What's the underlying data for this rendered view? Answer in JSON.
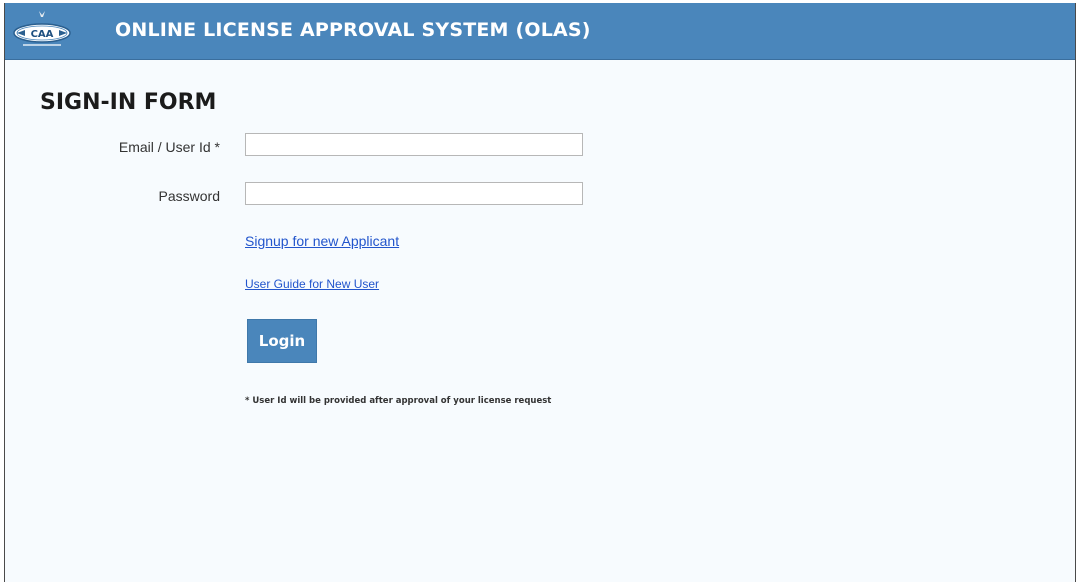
{
  "header": {
    "logo_text": "CAA",
    "title": "ONLINE LICENSE APPROVAL SYSTEM (OLAS)"
  },
  "form": {
    "title": "SIGN-IN FORM",
    "email_label": "Email / User Id *",
    "email_value": "",
    "password_label": "Password",
    "password_value": "",
    "signup_link": "Signup for new Applicant",
    "guide_link": "User Guide for New User",
    "login_label": "Login",
    "note": "* User Id will be provided after approval of your license request"
  },
  "colors": {
    "header_bg": "#4a86bb",
    "page_bg": "#f7fbfe",
    "link": "#2255cc",
    "button_bg": "#4a86bb"
  },
  "icons": {
    "logo": "caa-logo-icon"
  }
}
